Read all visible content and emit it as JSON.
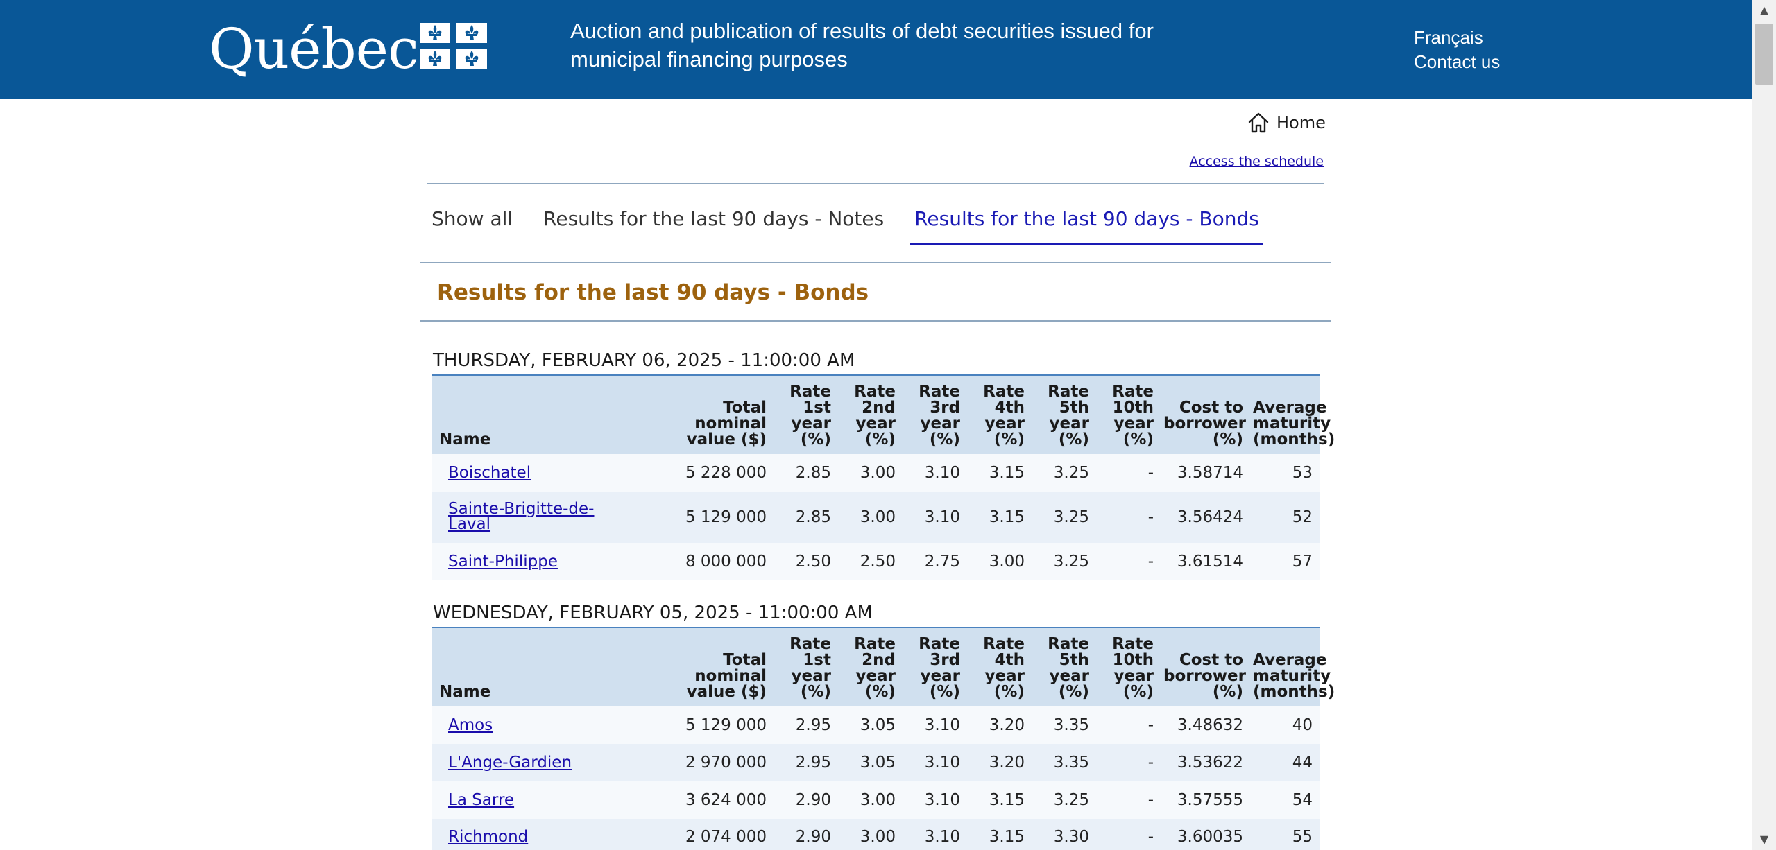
{
  "header": {
    "logo_text": "Québec",
    "title": "Auction and publication of results of debt securities issued for municipal financing purposes",
    "lang_link": "Français",
    "contact_link": "Contact us"
  },
  "nav": {
    "home": "Home",
    "schedule_link": "Access the schedule"
  },
  "tabs": [
    {
      "label": "Show all",
      "active": false
    },
    {
      "label": "Results for the last 90 days - Notes",
      "active": false
    },
    {
      "label": "Results for the last 90 days - Bonds",
      "active": true
    }
  ],
  "section_title": "Results for the last 90 days - Bonds",
  "columns": [
    "Name",
    "Total nominal value ($)",
    "Rate 1st year (%)",
    "Rate 2nd year (%)",
    "Rate 3rd year (%)",
    "Rate 4th year (%)",
    "Rate 5th year (%)",
    "Rate 10th year (%)",
    "Cost to borrower (%)",
    "Average maturity (months)"
  ],
  "auctions": [
    {
      "date": "THURSDAY, FEBRUARY 06, 2025 - 11:00:00 AM",
      "rows": [
        {
          "name": "Boischatel",
          "total": "5 228 000",
          "r1": "2.85",
          "r2": "3.00",
          "r3": "3.10",
          "r4": "3.15",
          "r5": "3.25",
          "r10": "-",
          "cost": "3.58714",
          "avg": "53"
        },
        {
          "name": "Sainte-Brigitte-de-Laval",
          "total": "5 129 000",
          "r1": "2.85",
          "r2": "3.00",
          "r3": "3.10",
          "r4": "3.15",
          "r5": "3.25",
          "r10": "-",
          "cost": "3.56424",
          "avg": "52"
        },
        {
          "name": "Saint-Philippe",
          "total": "8 000 000",
          "r1": "2.50",
          "r2": "2.50",
          "r3": "2.75",
          "r4": "3.00",
          "r5": "3.25",
          "r10": "-",
          "cost": "3.61514",
          "avg": "57"
        }
      ]
    },
    {
      "date": "WEDNESDAY, FEBRUARY 05, 2025 - 11:00:00 AM",
      "rows": [
        {
          "name": "Amos",
          "total": "5 129 000",
          "r1": "2.95",
          "r2": "3.05",
          "r3": "3.10",
          "r4": "3.20",
          "r5": "3.35",
          "r10": "-",
          "cost": "3.48632",
          "avg": "40"
        },
        {
          "name": "L'Ange-Gardien",
          "total": "2 970 000",
          "r1": "2.95",
          "r2": "3.05",
          "r3": "3.10",
          "r4": "3.20",
          "r5": "3.35",
          "r10": "-",
          "cost": "3.53622",
          "avg": "44"
        },
        {
          "name": "La Sarre",
          "total": "3 624 000",
          "r1": "2.90",
          "r2": "3.00",
          "r3": "3.10",
          "r4": "3.15",
          "r5": "3.25",
          "r10": "-",
          "cost": "3.57555",
          "avg": "54"
        },
        {
          "name": "Richmond",
          "total": "2 074 000",
          "r1": "2.90",
          "r2": "3.00",
          "r3": "3.10",
          "r4": "3.15",
          "r5": "3.30",
          "r10": "-",
          "cost": "3.60035",
          "avg": "55"
        }
      ]
    }
  ]
}
